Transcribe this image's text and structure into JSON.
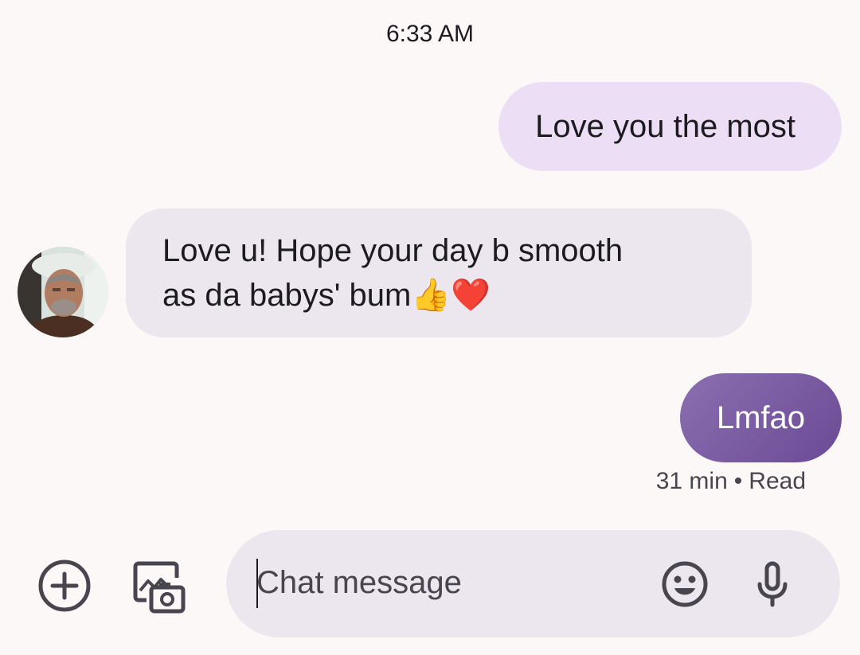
{
  "conversation": {
    "timestamp": "6:33 AM",
    "messages": [
      {
        "direction": "outgoing",
        "text": "Love you the most"
      },
      {
        "direction": "incoming",
        "line1": "Love u!  Hope your day b smooth",
        "line2_text": "as da babys' bum",
        "emojis": [
          "👍",
          "❤️"
        ]
      },
      {
        "direction": "outgoing",
        "text": "Lmfao",
        "status_time": "31 min",
        "status_separator": "•",
        "status_read": "Read"
      }
    ]
  },
  "compose": {
    "placeholder": "Chat message",
    "value": "",
    "icons": {
      "add": "add-circle-icon",
      "gallery": "gallery-camera-icon",
      "emoji": "emoji-smiley-icon",
      "mic": "microphone-icon"
    }
  },
  "colors": {
    "background": "#fdf8f8",
    "outgoing_bubble": "#ecdff5",
    "incoming_bubble": "#ece7ee",
    "outgoing_accent_start": "#8a6fb0",
    "outgoing_accent_end": "#6b4a95",
    "icon": "#49454f"
  }
}
